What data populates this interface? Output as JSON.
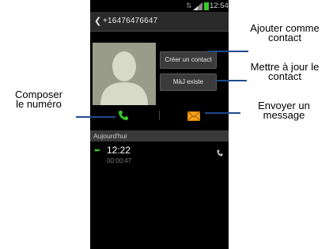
{
  "status_bar": {
    "time": "12:54"
  },
  "header": {
    "back_icon": "chevron-left-icon",
    "phone_number": "+16476476647"
  },
  "contact": {
    "photo_icon": "default-avatar-icon",
    "create_button": "Créer un contact",
    "update_button": "MàJ existe"
  },
  "actions": {
    "call_icon": "phone-call-icon",
    "message_icon": "envelope-icon"
  },
  "log": {
    "section_title": "Aujourd'hui",
    "entries": [
      {
        "time": "12:22",
        "duration": "00:00:47",
        "type_icon": "outgoing-arrow-icon"
      }
    ]
  },
  "annotations": {
    "add_contact_line1": "Ajouter comme",
    "add_contact_line2": "contact",
    "update_contact_line1": "Mettre à jour le",
    "update_contact_line2": "contact",
    "compose_line1": "Composer",
    "compose_line2": "le numéro",
    "send_message_line1": "Envoyer un",
    "send_message_line2": "message"
  },
  "colors": {
    "accent_green": "#37c928",
    "message_orange": "#f7a21b",
    "callout_line": "#1f4a8c"
  }
}
